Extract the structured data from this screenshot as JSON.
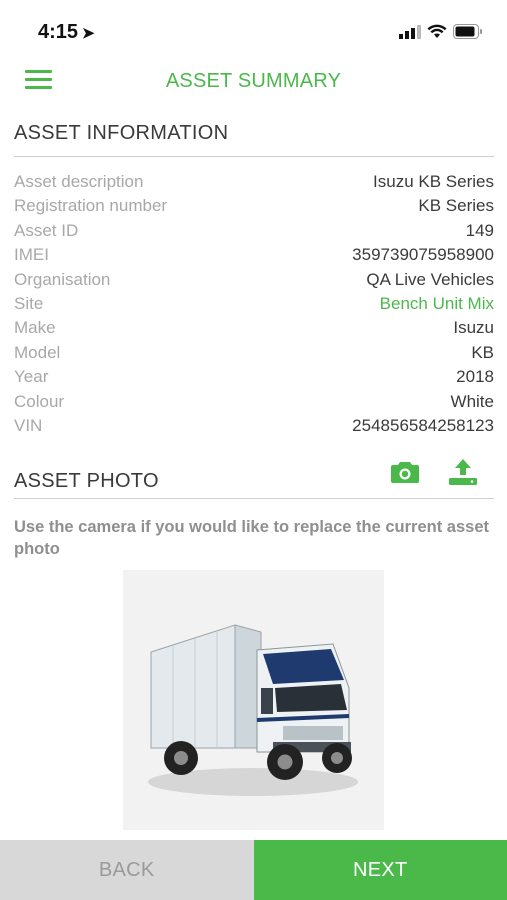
{
  "status_bar": {
    "time": "4:15"
  },
  "header": {
    "title": "ASSET SUMMARY"
  },
  "asset_info": {
    "section_title": "ASSET INFORMATION",
    "rows": [
      {
        "label": "Asset description",
        "value": "Isuzu KB Series"
      },
      {
        "label": "Registration number",
        "value": "KB Series"
      },
      {
        "label": "Asset ID",
        "value": "149"
      },
      {
        "label": "IMEI",
        "value": "359739075958900"
      },
      {
        "label": "Organisation",
        "value": "QA Live Vehicles"
      },
      {
        "label": "Site",
        "value": "Bench Unit Mix"
      },
      {
        "label": "Make",
        "value": "Isuzu"
      },
      {
        "label": "Model",
        "value": "KB"
      },
      {
        "label": "Year",
        "value": "2018"
      },
      {
        "label": "Colour",
        "value": "White"
      },
      {
        "label": "VIN",
        "value": "254856584258123"
      }
    ]
  },
  "asset_photo": {
    "section_title": "ASSET PHOTO",
    "hint": "Use the camera if you would like to replace the current asset photo"
  },
  "footer": {
    "back_label": "BACK",
    "next_label": "NEXT"
  },
  "colors": {
    "accent": "#4ab94a",
    "back_bg": "#d8d8d8"
  }
}
